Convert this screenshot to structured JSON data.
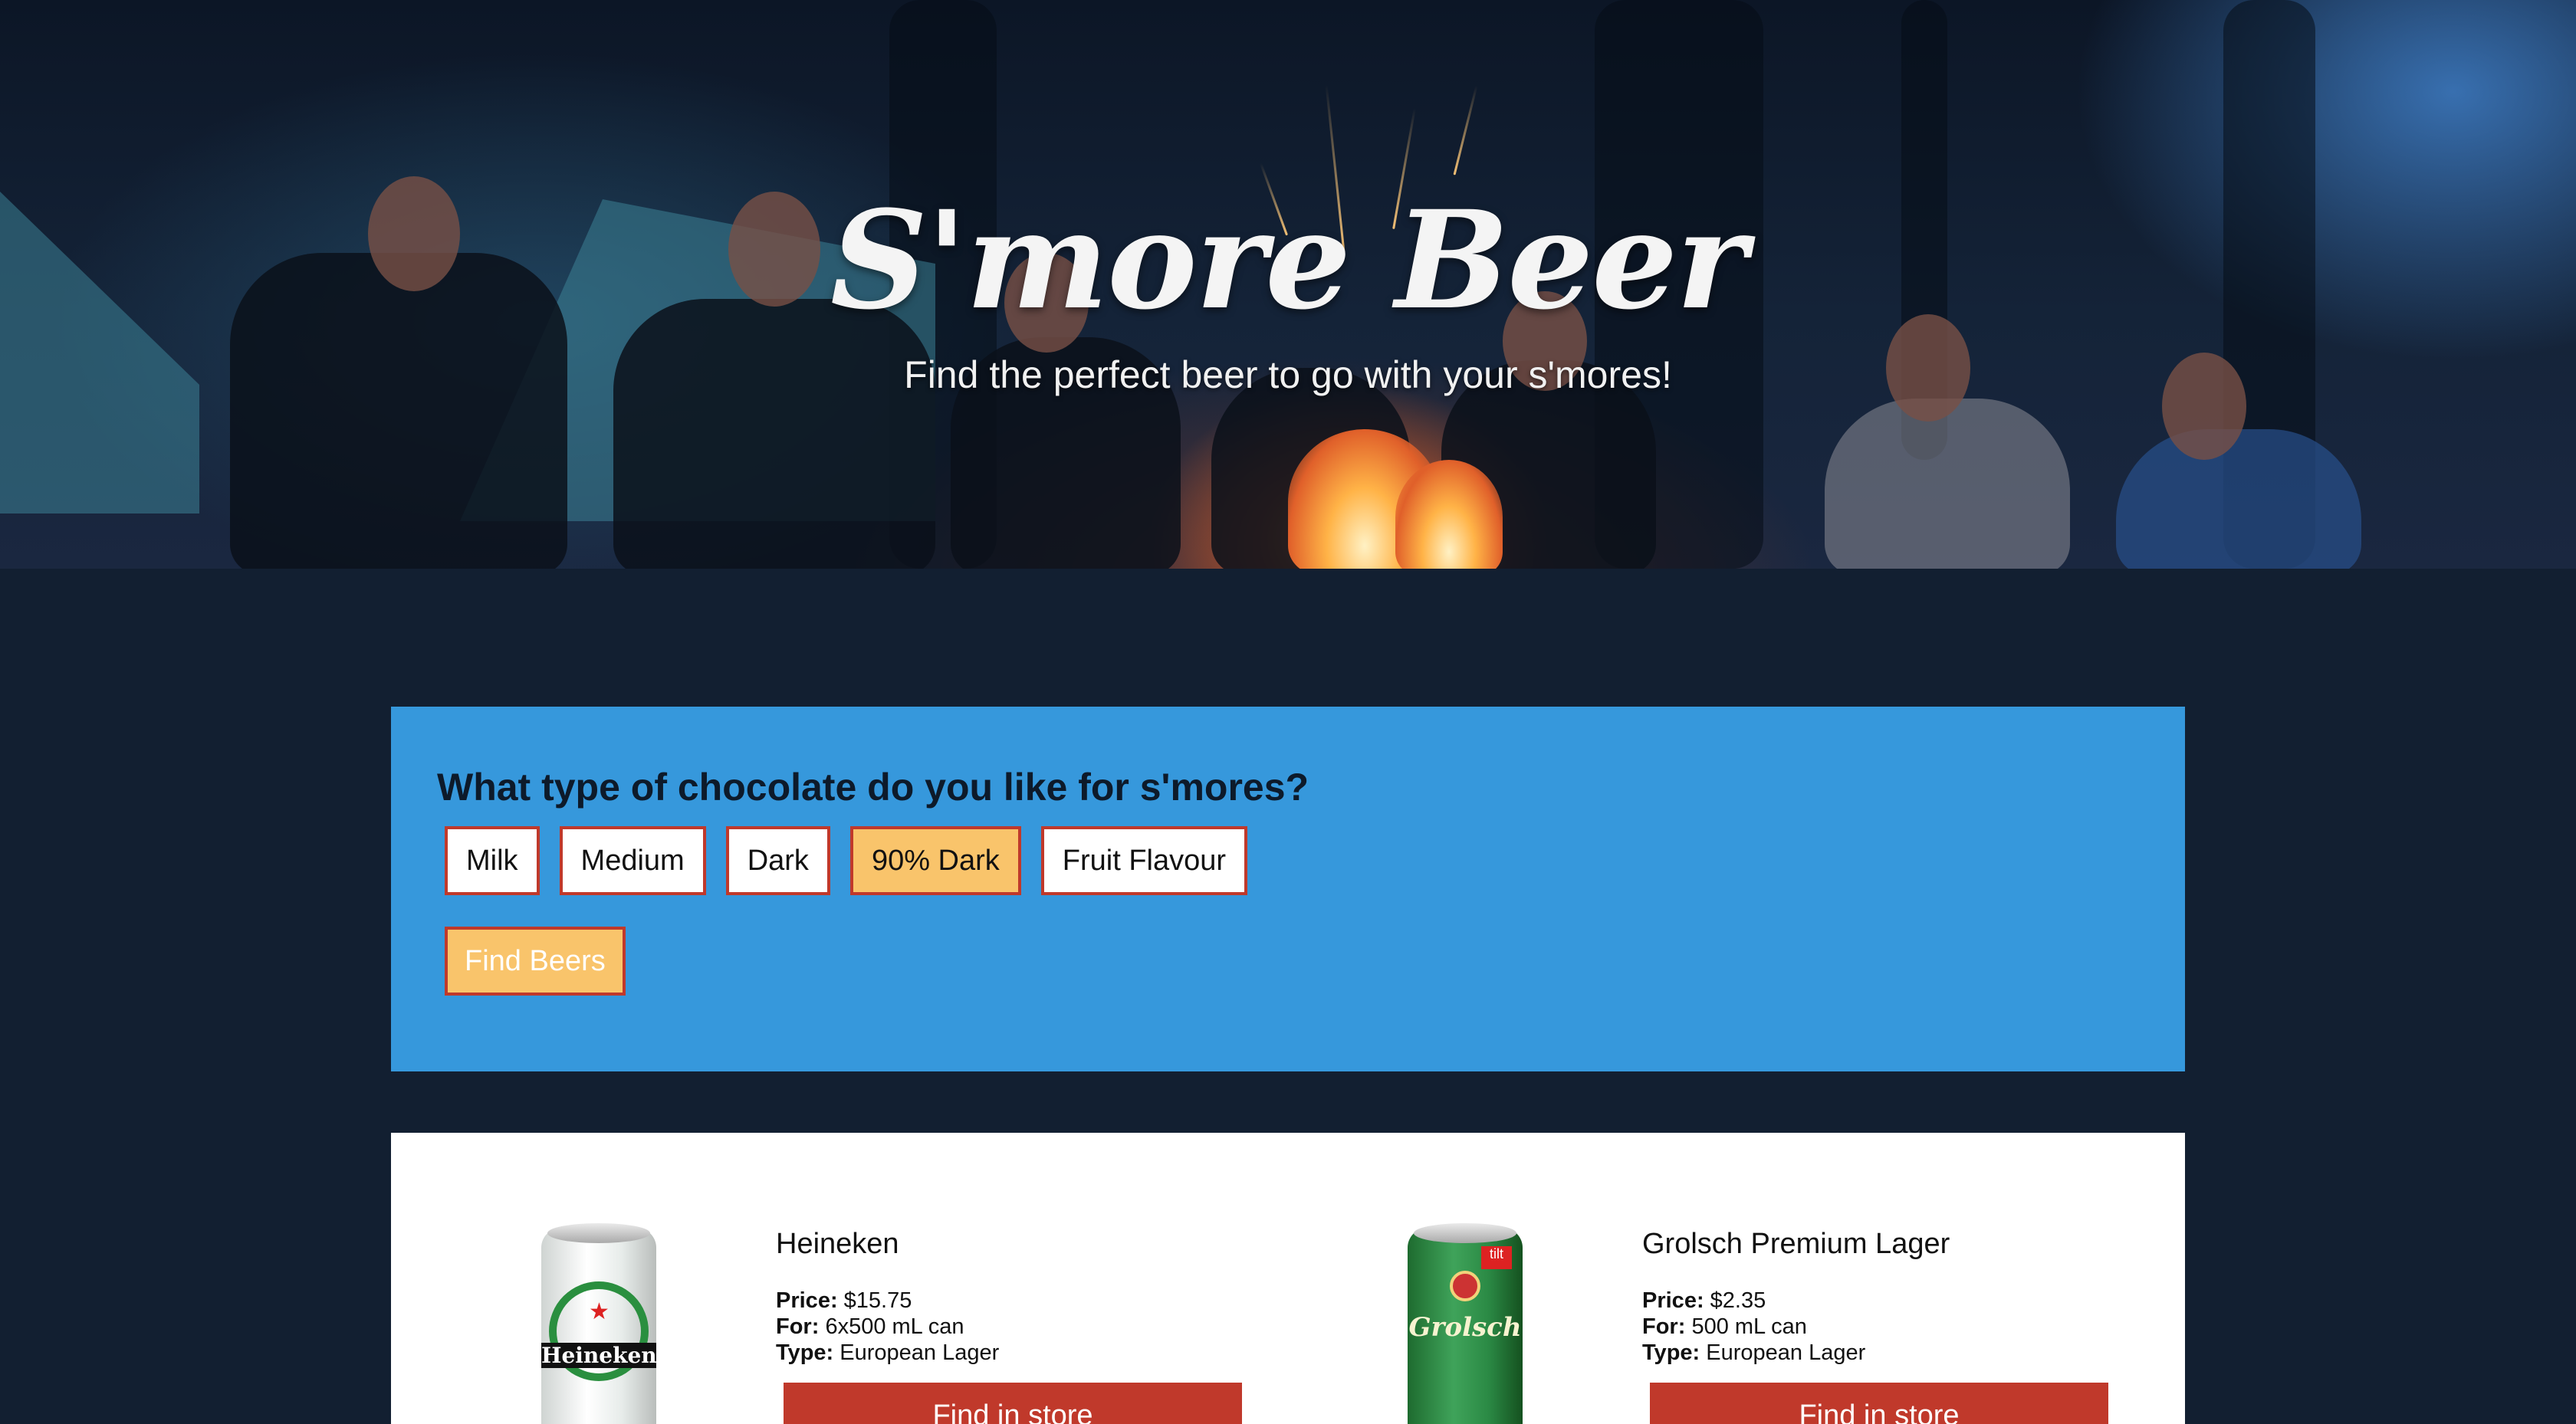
{
  "hero": {
    "title": "S'more Beer",
    "subtitle": "Find the perfect beer to go with your s'mores!"
  },
  "quiz": {
    "question": "What type of chocolate do you like for s'mores?",
    "options": [
      {
        "label": "Milk",
        "selected": false
      },
      {
        "label": "Medium",
        "selected": false
      },
      {
        "label": "Dark",
        "selected": false
      },
      {
        "label": "90% Dark",
        "selected": true
      },
      {
        "label": "Fruit Flavour",
        "selected": false
      }
    ],
    "find_button": "Find Beers"
  },
  "results": [
    {
      "name": "Heineken",
      "price_label": "Price:",
      "price": "$15.75",
      "for_label": "For:",
      "for": "6x500 mL can",
      "type_label": "Type:",
      "type": "European Lager",
      "button": "Find in store",
      "can_text": "Heineken"
    },
    {
      "name": "Grolsch Premium Lager",
      "price_label": "Price:",
      "price": "$2.35",
      "for_label": "For:",
      "for": "500 mL can",
      "type_label": "Type:",
      "type": "European Lager",
      "button": "Find in store",
      "can_text": "Grolsch"
    }
  ],
  "colors": {
    "page_bg": "#121f31",
    "quiz_bg": "#3698dc",
    "accent_red": "#c0392b",
    "selected_yellow": "#f9c46b"
  }
}
